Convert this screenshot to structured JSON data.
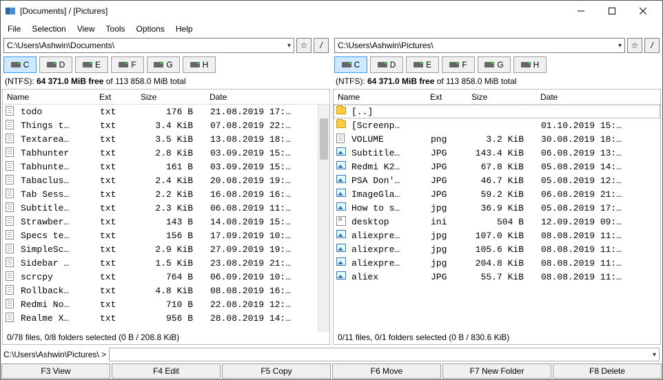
{
  "window": {
    "title": "[Documents] / [Pictures]"
  },
  "menu": [
    "File",
    "Selection",
    "View",
    "Tools",
    "Options",
    "Help"
  ],
  "left": {
    "addr_path": "C:\\Users\\Ashwin\\Documents\\",
    "fs_line_prefix": "(NTFS): ",
    "fs_line_free": "64 371.0 MiB free",
    "fs_line_suffix": " of 113 858.0 MiB total",
    "drives": [
      "C",
      "D",
      "E",
      "F",
      "G",
      "H"
    ],
    "headers": {
      "name": "Name",
      "ext": "Ext",
      "size": "Size",
      "date": "Date"
    },
    "rows": [
      {
        "icon": "doc",
        "name": "todo",
        "ext": "txt",
        "size": "176 B",
        "date": "21.08.2019 17:…"
      },
      {
        "icon": "doc",
        "name": "Things t…",
        "ext": "txt",
        "size": "3.4 KiB",
        "date": "07.08.2019 22:…"
      },
      {
        "icon": "doc",
        "name": "Textarea…",
        "ext": "txt",
        "size": "3.5 KiB",
        "date": "13.08.2019 18:…"
      },
      {
        "icon": "doc",
        "name": "Tabhunter",
        "ext": "txt",
        "size": "2.8 KiB",
        "date": "03.09.2019 15:…"
      },
      {
        "icon": "doc",
        "name": "Tabhunte…",
        "ext": "txt",
        "size": "161 B",
        "date": "03.09.2019 15:…"
      },
      {
        "icon": "doc",
        "name": "Tabaclus…",
        "ext": "txt",
        "size": "2.4 KiB",
        "date": "20.08.2019 19:…"
      },
      {
        "icon": "doc",
        "name": "Tab Sess…",
        "ext": "txt",
        "size": "2.2 KiB",
        "date": "16.08.2019 16:…"
      },
      {
        "icon": "doc",
        "name": "Subtitle…",
        "ext": "txt",
        "size": "2.3 KiB",
        "date": "06.08.2019 11:…"
      },
      {
        "icon": "doc",
        "name": "Strawber…",
        "ext": "txt",
        "size": "143 B",
        "date": "14.08.2019 15:…"
      },
      {
        "icon": "doc",
        "name": "Specs te…",
        "ext": "txt",
        "size": "156 B",
        "date": "17.09.2019 10:…"
      },
      {
        "icon": "doc",
        "name": "SimpleSc…",
        "ext": "txt",
        "size": "2.9 KiB",
        "date": "27.09.2019 19:…"
      },
      {
        "icon": "doc",
        "name": "Sidebar …",
        "ext": "txt",
        "size": "1.5 KiB",
        "date": "23.08.2019 21:…"
      },
      {
        "icon": "doc",
        "name": "scrcpy",
        "ext": "txt",
        "size": "764 B",
        "date": "06.09.2019 10:…"
      },
      {
        "icon": "doc",
        "name": "Rollback…",
        "ext": "txt",
        "size": "4.8 KiB",
        "date": "08.08.2019 16:…"
      },
      {
        "icon": "doc",
        "name": "Redmi No…",
        "ext": "txt",
        "size": "710 B",
        "date": "22.08.2019 12:…"
      },
      {
        "icon": "doc",
        "name": "Realme X…",
        "ext": "txt",
        "size": "956 B",
        "date": "28.08.2019 14:…"
      }
    ],
    "status": "0/78 files, 0/8 folders selected (0 B / 208.8 KiB)"
  },
  "right": {
    "addr_path": "C:\\Users\\Ashwin\\Pictures\\",
    "fs_line_prefix": "(NTFS): ",
    "fs_line_free": "64 371.0 MiB free",
    "fs_line_suffix": " of 113 858.0 MiB total",
    "drives": [
      "C",
      "D",
      "E",
      "F",
      "G",
      "H"
    ],
    "headers": {
      "name": "Name",
      "ext": "Ext",
      "size": "Size",
      "date": "Date"
    },
    "rows": [
      {
        "icon": "fold-up",
        "name": "[..]",
        "ext": "",
        "size": "",
        "date": "",
        "focused": true
      },
      {
        "icon": "fold",
        "name": "[Screenp…",
        "ext": "",
        "size": "",
        "date": "01.10.2019 15:…"
      },
      {
        "icon": "doc",
        "name": "VOLUME",
        "ext": "png",
        "size": "3.2 KiB",
        "date": "30.08.2019 18:…"
      },
      {
        "icon": "img",
        "name": "Subtitle…",
        "ext": "JPG",
        "size": "143.4 KiB",
        "date": "06.08.2019 13:…"
      },
      {
        "icon": "img",
        "name": "Redmi K2…",
        "ext": "JPG",
        "size": "67.8 KiB",
        "date": "05.08.2019 14:…"
      },
      {
        "icon": "img",
        "name": "PSA Don'…",
        "ext": "JPG",
        "size": "46.7 KiB",
        "date": "05.08.2019 12:…"
      },
      {
        "icon": "img",
        "name": "ImageGla…",
        "ext": "JPG",
        "size": "59.2 KiB",
        "date": "06.08.2019 21:…"
      },
      {
        "icon": "img",
        "name": "How to s…",
        "ext": "jpg",
        "size": "36.9 KiB",
        "date": "05.08.2019 17:…"
      },
      {
        "icon": "ini",
        "name": "desktop",
        "ext": "ini",
        "size": "504 B",
        "date": "12.09.2019 09:…"
      },
      {
        "icon": "img",
        "name": "aliexpre…",
        "ext": "jpg",
        "size": "107.0 KiB",
        "date": "08.08.2019 11:…"
      },
      {
        "icon": "img",
        "name": "aliexpre…",
        "ext": "jpg",
        "size": "105.6 KiB",
        "date": "08.08.2019 11:…"
      },
      {
        "icon": "img",
        "name": "aliexpre…",
        "ext": "jpg",
        "size": "204.8 KiB",
        "date": "08.08.2019 11:…"
      },
      {
        "icon": "img",
        "name": "aliex",
        "ext": "JPG",
        "size": "55.7 KiB",
        "date": "08.08.2019 11:…"
      }
    ],
    "status": "0/11 files, 0/1 folders selected (0 B / 830.6 KiB)"
  },
  "cmdline_label": "C:\\Users\\Ashwin\\Pictures\\ >",
  "fnkeys": [
    "F3 View",
    "F4 Edit",
    "F5 Copy",
    "F6 Move",
    "F7 New Folder",
    "F8 Delete"
  ]
}
